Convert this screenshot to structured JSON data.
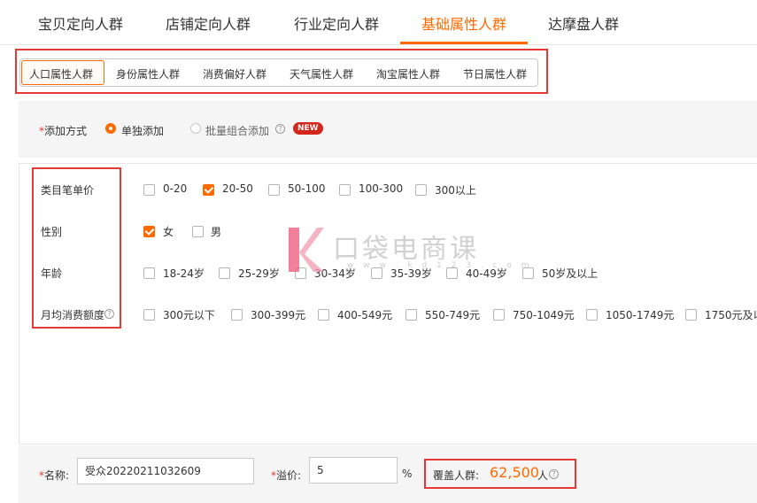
{
  "top_tabs": [
    {
      "label": "宝贝定向人群"
    },
    {
      "label": "店铺定向人群"
    },
    {
      "label": "行业定向人群"
    },
    {
      "label": "基础属性人群"
    },
    {
      "label": "达摩盘人群"
    }
  ],
  "sub_tabs": [
    {
      "label": "人口属性人群"
    },
    {
      "label": "身份属性人群"
    },
    {
      "label": "消费偏好人群"
    },
    {
      "label": "天气属性人群"
    },
    {
      "label": "淘宝属性人群"
    },
    {
      "label": "节日属性人群"
    }
  ],
  "add_method": {
    "required_mark": "*",
    "label": "添加方式",
    "single": "单独添加",
    "batch": "批量组合添加",
    "new_badge": "NEW"
  },
  "attributes": {
    "price": {
      "label": "类目笔单价",
      "options": [
        "0-20",
        "20-50",
        "50-100",
        "100-300",
        "300以上"
      ]
    },
    "gender": {
      "label": "性别",
      "options": [
        "女",
        "男"
      ]
    },
    "age": {
      "label": "年龄",
      "options": [
        "18-24岁",
        "25-29岁",
        "30-34岁",
        "35-39岁",
        "40-49岁",
        "50岁及以上"
      ]
    },
    "spend": {
      "label": "月均消费额度",
      "options": [
        "300元以下",
        "300-399元",
        "400-549元",
        "550-749元",
        "750-1049元",
        "1050-1749元",
        "1750元及以"
      ]
    }
  },
  "watermark": {
    "brand": "口袋电商课",
    "url": "w w w . k d 1 2 3 . c o m"
  },
  "form": {
    "required_mark": "*",
    "name_label": "名称:",
    "name_value": "受众20220211032609",
    "premium_label": "溢价:",
    "premium_value": "5",
    "percent": "%",
    "coverage_label": "覆盖人群:",
    "coverage_value": "62,500",
    "coverage_unit": "人"
  },
  "colors": {
    "accent": "#ff6a00",
    "highlight": "#e53935",
    "badge": "#d4271b"
  }
}
